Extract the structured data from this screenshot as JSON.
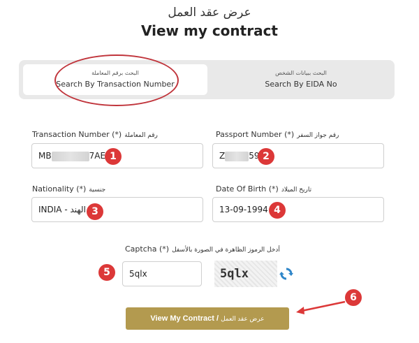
{
  "header": {
    "title_ar": "عرض عقد العمل",
    "title_en": "View my contract"
  },
  "tabs": [
    {
      "label_ar": "البحث برقم المعاملة",
      "label_en": "Search By Transaction Number",
      "active": true
    },
    {
      "label_ar": "البحث ببيانات الشخص",
      "label_en": "Search By EIDA No",
      "active": false
    }
  ],
  "form": {
    "transaction_number": {
      "label_en": "Transaction Number (*)",
      "label_ar": "رقم المعاملة",
      "value_prefix": "MB",
      "value_suffix": "7AE"
    },
    "passport_number": {
      "label_en": "Passport Number (*)",
      "label_ar": "رقم جواز السفر",
      "value_prefix": "Z",
      "value_suffix": "59"
    },
    "nationality": {
      "label_en": "Nationality (*)",
      "label_ar": "جنسية",
      "value": "INDIA - الهند"
    },
    "date_of_birth": {
      "label_en": "Date Of Birth (*)",
      "label_ar": "تاريخ الميلاد",
      "value": "13-09-1994"
    },
    "captcha": {
      "label_en": "Captcha (*)",
      "label_ar": "أدخل الرموز الظاهرة في الصورة بالأسفل",
      "value": "5qlx",
      "image_text": "5qlx"
    }
  },
  "submit": {
    "label_en": "View My Contract /",
    "label_ar": "عرض عقد العمل"
  },
  "badges": [
    "1",
    "2",
    "3",
    "4",
    "5",
    "6"
  ],
  "colors": {
    "badge": "#dc3838",
    "button": "#b39a4f",
    "highlight": "#c0343b",
    "refresh": "#2f86c9"
  }
}
